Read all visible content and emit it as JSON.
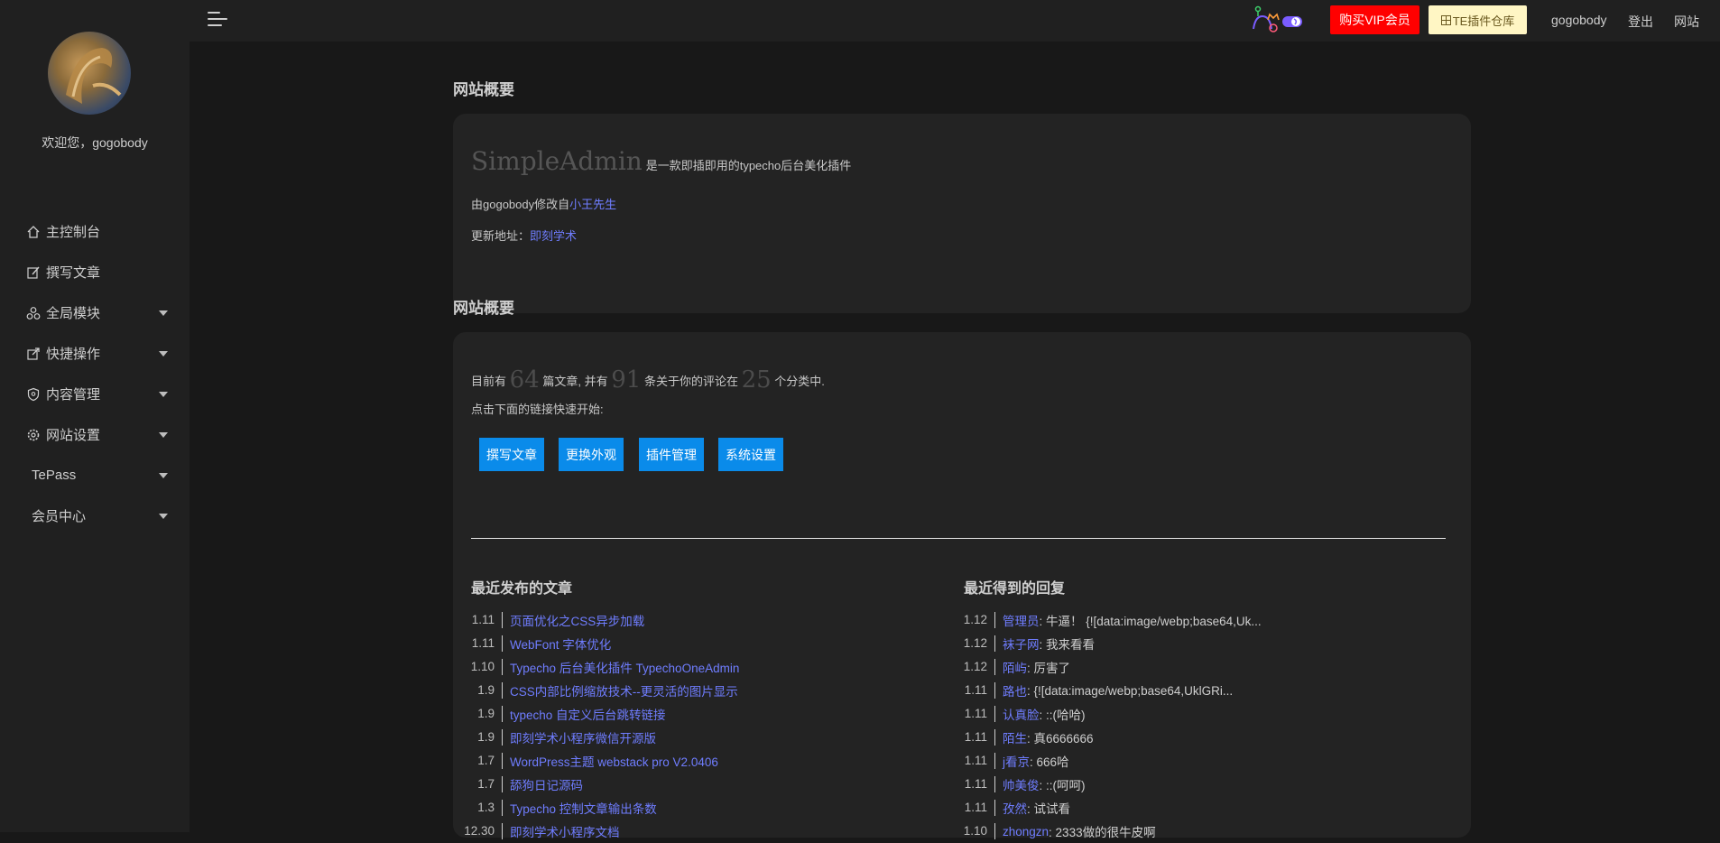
{
  "sidebar": {
    "welcome": "欢迎您，gogobody",
    "items": [
      {
        "label": "主控制台",
        "icon": "home-icon",
        "has_caret": false
      },
      {
        "label": "撰写文章",
        "icon": "edit-icon",
        "has_caret": false
      },
      {
        "label": "全局模块",
        "icon": "modules-icon",
        "has_caret": true
      },
      {
        "label": "快捷操作",
        "icon": "external-link-icon",
        "has_caret": true
      },
      {
        "label": "内容管理",
        "icon": "shield-icon",
        "has_caret": true
      },
      {
        "label": "网站设置",
        "icon": "gear-icon",
        "has_caret": true
      },
      {
        "label": "TePass",
        "icon": "",
        "has_caret": true
      },
      {
        "label": "会员中心",
        "icon": "",
        "has_caret": true
      }
    ]
  },
  "topbar": {
    "vip_button": "购买VIP会员",
    "te_button": "TE插件仓库",
    "user": "gogobody",
    "logout": "登出",
    "site": "网站"
  },
  "overview1": {
    "title": "网站概要",
    "brand": "SimpleAdmin",
    "tagline": "是一款即插即用的typecho后台美化插件",
    "modified_prefix": "由gogobody修改自",
    "modified_link": "小王先生",
    "update_prefix": "更新地址：",
    "update_link": "即刻学术"
  },
  "overview2": {
    "title": "网站概要",
    "stat_prefix": "目前有",
    "posts": "64",
    "posts_suffix": "篇文章, 并有",
    "comments": "91",
    "comments_suffix": "条关于你的评论在",
    "categories": "25",
    "categories_suffix": "个分类中.",
    "hint": "点击下面的链接快速开始:",
    "buttons": [
      "撰写文章",
      "更换外观",
      "插件管理",
      "系统设置"
    ]
  },
  "recent_posts": {
    "title": "最近发布的文章",
    "items": [
      {
        "date": "1.11",
        "title": "页面优化之CSS异步加载"
      },
      {
        "date": "1.11",
        "title": "WebFont 字体优化"
      },
      {
        "date": "1.10",
        "title": "Typecho 后台美化插件 TypechoOneAdmin"
      },
      {
        "date": "1.9",
        "title": "CSS内部比例缩放技术--更灵活的图片显示"
      },
      {
        "date": "1.9",
        "title": "typecho 自定义后台跳转链接"
      },
      {
        "date": "1.9",
        "title": "即刻学术小程序微信开源版"
      },
      {
        "date": "1.7",
        "title": "WordPress主题 webstack pro V2.0406"
      },
      {
        "date": "1.7",
        "title": "舔狗日记源码"
      },
      {
        "date": "1.3",
        "title": "Typecho 控制文章输出条数"
      },
      {
        "date": "12.30",
        "title": "即刻学术小程序文档"
      }
    ]
  },
  "recent_replies": {
    "title": "最近得到的回复",
    "items": [
      {
        "date": "1.12",
        "author": "管理员",
        "text": ": 牛逼！ {![data:image/webp;base64,Uk..."
      },
      {
        "date": "1.12",
        "author": "袜子网",
        "text": ": 我来看看"
      },
      {
        "date": "1.12",
        "author": "陌屿",
        "text": ": 厉害了"
      },
      {
        "date": "1.11",
        "author": "路也",
        "text": ": {![data:image/webp;base64,UklGRi..."
      },
      {
        "date": "1.11",
        "author": "认真脸",
        "text": ": ::(哈哈)"
      },
      {
        "date": "1.11",
        "author": "陌生",
        "text": ": 真6666666"
      },
      {
        "date": "1.11",
        "author": "j看京",
        "text": ": 666哈"
      },
      {
        "date": "1.11",
        "author": "帅美俊",
        "text": ": ::(呵呵)"
      },
      {
        "date": "1.11",
        "author": "孜然",
        "text": ": 试试看"
      },
      {
        "date": "1.10",
        "author": "zhongzn",
        "text": ": 2333做的很牛皮啊"
      }
    ]
  }
}
